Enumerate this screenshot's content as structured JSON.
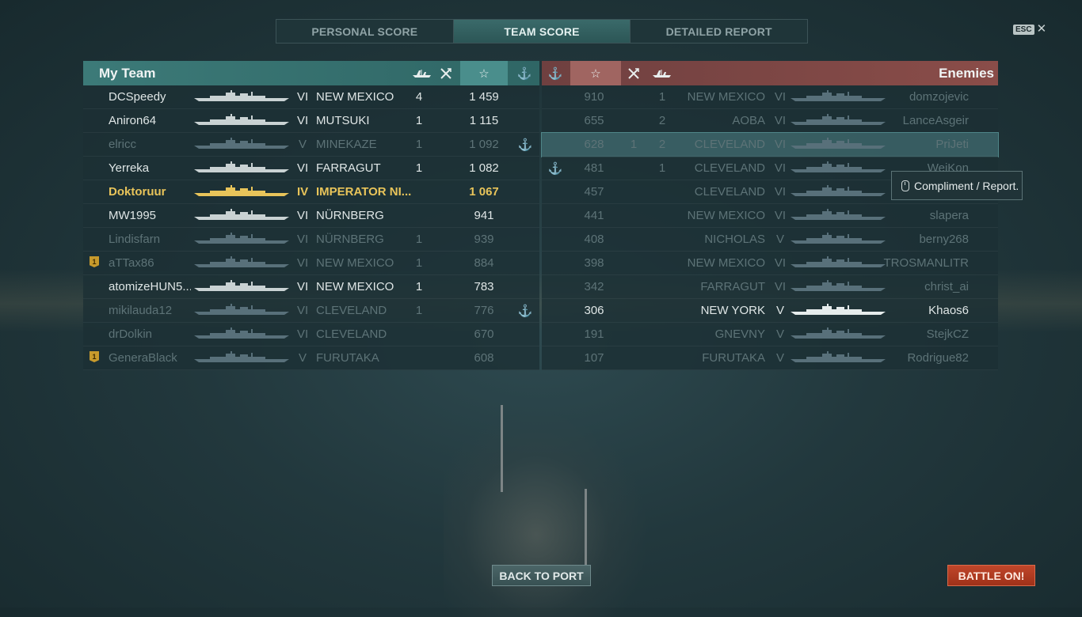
{
  "tabs": [
    {
      "label": "PERSONAL SCORE"
    },
    {
      "label": "TEAM SCORE"
    },
    {
      "label": "DETAILED REPORT"
    }
  ],
  "esc": {
    "key": "ESC",
    "close": "✕"
  },
  "my_team": {
    "title": "My Team",
    "header_icons": {
      "planes": "aircraft-icon",
      "kills": "crossed-swords-icon",
      "score": "☆",
      "anchor": "⚓"
    },
    "rows": [
      {
        "name": "DCSpeedy",
        "tier": "VI",
        "ship": "NEW MEXICO",
        "kills": "4",
        "score": "1 459",
        "anchor": "",
        "badge": "",
        "state": "alive"
      },
      {
        "name": "Aniron64",
        "tier": "VI",
        "ship": "MUTSUKI",
        "kills": "1",
        "score": "1 115",
        "anchor": "",
        "badge": "",
        "state": "alive"
      },
      {
        "name": "elricc",
        "tier": "V",
        "ship": "MINEKAZE",
        "kills": "1",
        "score": "1 092",
        "anchor": "⚓",
        "badge": "",
        "state": "dim"
      },
      {
        "name": "Yerreka",
        "tier": "VI",
        "ship": "FARRAGUT",
        "kills": "1",
        "score": "1 082",
        "anchor": "",
        "badge": "",
        "state": "alive"
      },
      {
        "name": "Doktoruur",
        "tier": "IV",
        "ship": "IMPERATOR NI...",
        "kills": "",
        "score": "1 067",
        "anchor": "",
        "badge": "",
        "state": "me"
      },
      {
        "name": "MW1995",
        "tier": "VI",
        "ship": "NÜRNBERG",
        "kills": "",
        "score": "941",
        "anchor": "",
        "badge": "",
        "state": "alive"
      },
      {
        "name": "Lindisfarn",
        "tier": "VI",
        "ship": "NÜRNBERG",
        "kills": "1",
        "score": "939",
        "anchor": "",
        "badge": "",
        "state": "dim"
      },
      {
        "name": "aTTax86",
        "tier": "VI",
        "ship": "NEW MEXICO",
        "kills": "1",
        "score": "884",
        "anchor": "",
        "badge": "1",
        "state": "dim"
      },
      {
        "name": "atomizeHUN5...",
        "tier": "VI",
        "ship": "NEW MEXICO",
        "kills": "1",
        "score": "783",
        "anchor": "",
        "badge": "",
        "state": "alive"
      },
      {
        "name": "mikilauda12",
        "tier": "VI",
        "ship": "CLEVELAND",
        "kills": "1",
        "score": "776",
        "anchor": "⚓",
        "badge": "",
        "state": "dim"
      },
      {
        "name": "drDolkin",
        "tier": "VI",
        "ship": "CLEVELAND",
        "kills": "",
        "score": "670",
        "anchor": "",
        "badge": "",
        "state": "dim"
      },
      {
        "name": "GeneraBlack",
        "tier": "V",
        "ship": "FURUTAKA",
        "kills": "",
        "score": "608",
        "anchor": "",
        "badge": "1",
        "state": "dim"
      }
    ]
  },
  "enemies": {
    "title": "Enemies",
    "rows": [
      {
        "anchor": "",
        "score": "910",
        "planes": "",
        "kills": "1",
        "ship": "NEW MEXICO",
        "tier": "VI",
        "name": "domzojevic",
        "state": "dim"
      },
      {
        "anchor": "",
        "score": "655",
        "planes": "",
        "kills": "2",
        "ship": "AOBA",
        "tier": "VI",
        "name": "LanceAsgeir",
        "state": "dim"
      },
      {
        "anchor": "",
        "score": "628",
        "planes": "1",
        "kills": "2",
        "ship": "CLEVELAND",
        "tier": "VI",
        "name": "PriJeti",
        "state": "dim",
        "highlight": true
      },
      {
        "anchor": "⚓",
        "score": "481",
        "planes": "",
        "kills": "1",
        "ship": "CLEVELAND",
        "tier": "VI",
        "name": "WeiKon",
        "state": "dim"
      },
      {
        "anchor": "",
        "score": "457",
        "planes": "",
        "kills": "",
        "ship": "CLEVELAND",
        "tier": "VI",
        "name": "",
        "state": "dim"
      },
      {
        "anchor": "",
        "score": "441",
        "planes": "",
        "kills": "",
        "ship": "NEW MEXICO",
        "tier": "VI",
        "name": "slapera",
        "state": "dim"
      },
      {
        "anchor": "",
        "score": "408",
        "planes": "",
        "kills": "",
        "ship": "NICHOLAS",
        "tier": "V",
        "name": "berny268",
        "state": "dim"
      },
      {
        "anchor": "",
        "score": "398",
        "planes": "",
        "kills": "",
        "ship": "NEW MEXICO",
        "tier": "VI",
        "name": "TROSMANLITR",
        "state": "dim"
      },
      {
        "anchor": "",
        "score": "342",
        "planes": "",
        "kills": "",
        "ship": "FARRAGUT",
        "tier": "VI",
        "name": "christ_ai",
        "state": "dim"
      },
      {
        "anchor": "",
        "score": "306",
        "planes": "",
        "kills": "",
        "ship": "NEW YORK",
        "tier": "V",
        "name": "Khaos6",
        "state": "alive"
      },
      {
        "anchor": "",
        "score": "191",
        "planes": "",
        "kills": "",
        "ship": "GNEVNY",
        "tier": "V",
        "name": "StejkCZ",
        "state": "dim"
      },
      {
        "anchor": "",
        "score": "107",
        "planes": "",
        "kills": "",
        "ship": "FURUTAKA",
        "tier": "V",
        "name": "Rodrigue82",
        "state": "dim"
      }
    ]
  },
  "tooltip": {
    "text": "Compliment / Report.",
    "icon": "mouse-icon"
  },
  "buttons": {
    "back_to_port": "BACK TO PORT",
    "battle_on": "BATTLE ON!"
  },
  "colors": {
    "my_team_header": "#3c7a78",
    "enemy_header": "#8a4d49",
    "highlight_player": "#e8c45a",
    "battle_button": "#c0462a"
  }
}
